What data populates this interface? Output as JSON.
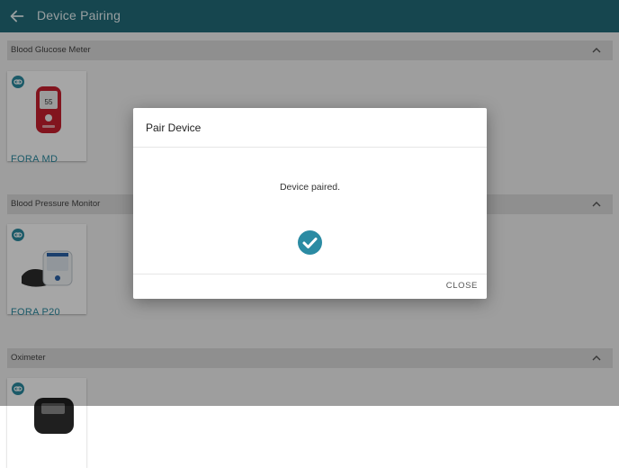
{
  "appbar": {
    "title": "Device Pairing",
    "back_icon": "arrow-left-icon"
  },
  "sections": [
    {
      "label": "Blood Glucose Meter",
      "device": {
        "name": "FORA MD",
        "icon": "glucose-meter-icon"
      }
    },
    {
      "label": "Blood Pressure Monitor",
      "device": {
        "name": "FORA P20",
        "icon": "blood-pressure-monitor-icon"
      }
    },
    {
      "label": "Oximeter",
      "device": {
        "icon": "oximeter-icon"
      }
    }
  ],
  "dialog": {
    "title": "Pair Device",
    "message": "Device paired.",
    "status_icon": "check-circle-icon",
    "close_label": "CLOSE"
  },
  "colors": {
    "appbar": "#236c7a",
    "accent": "#2a8aa0",
    "section_header": "#dcdcdc"
  }
}
